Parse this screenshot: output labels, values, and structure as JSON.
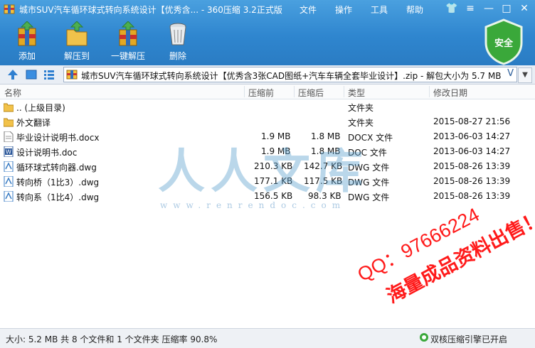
{
  "window": {
    "title": "城市SUV汽车循环球式转向系统设计【优秀含... - 360压缩 3.2正式版",
    "menu": [
      "文件",
      "操作",
      "工具",
      "帮助"
    ],
    "controls": {
      "skin": "👕",
      "menu": "≡",
      "minimize": "—",
      "maximize": "□",
      "close": "✕"
    }
  },
  "toolbar": {
    "add_label": "添加",
    "extract_label": "解压到",
    "one_click_label": "一键解压",
    "delete_label": "删除"
  },
  "security": {
    "label": "安全",
    "color": "#3aa83a"
  },
  "address": {
    "path": "城市SUV汽车循环球式转向系统设计【优秀含3张CAD图纸+汽车车辆全套毕业设计】.zip - 解包大小为 5.7 MB",
    "chevron": "V"
  },
  "columns": [
    "名称",
    "压缩前",
    "压缩后",
    "类型",
    "修改日期"
  ],
  "rows": [
    {
      "name": ".. (上级目录)",
      "size": "",
      "packed": "",
      "type": "文件夹",
      "date": "",
      "icon": "folder-icon"
    },
    {
      "name": "外文翻译",
      "size": "",
      "packed": "",
      "type": "文件夹",
      "date": "2015-08-27 21:56",
      "icon": "folder-icon"
    },
    {
      "name": "毕业设计说明书.docx",
      "size": "1.9 MB",
      "packed": "1.8 MB",
      "type": "DOCX 文件",
      "date": "2013-06-03 14:27",
      "icon": "document-icon"
    },
    {
      "name": "设计说明书.doc",
      "size": "1.9 MB",
      "packed": "1.8 MB",
      "type": "DOC 文件",
      "date": "2013-06-03 14:27",
      "icon": "word-icon"
    },
    {
      "name": "循环球式转向器.dwg",
      "size": "210.3 KB",
      "packed": "142.7 KB",
      "type": "DWG 文件",
      "date": "2015-08-26 13:39",
      "icon": "dwg-icon"
    },
    {
      "name": "转向桥（1比3）.dwg",
      "size": "177.1 KB",
      "packed": "117.5 KB",
      "type": "DWG 文件",
      "date": "2015-08-26 13:39",
      "icon": "dwg-icon"
    },
    {
      "name": "转向系（1比4）.dwg",
      "size": "156.5 KB",
      "packed": "98.3 KB",
      "type": "DWG 文件",
      "date": "2015-08-26 13:39",
      "icon": "dwg-icon"
    }
  ],
  "watermark": {
    "main": "人人文库",
    "url": "www.renrendoc.com",
    "promo_line1": "QQ：97666224",
    "promo_line2": "海量成品资料出售！"
  },
  "status": {
    "summary": "大小: 5.2 MB 共 8 个文件和 1 个文件夹 压缩率 90.8%",
    "engine": "双核压缩引擎已开启"
  }
}
